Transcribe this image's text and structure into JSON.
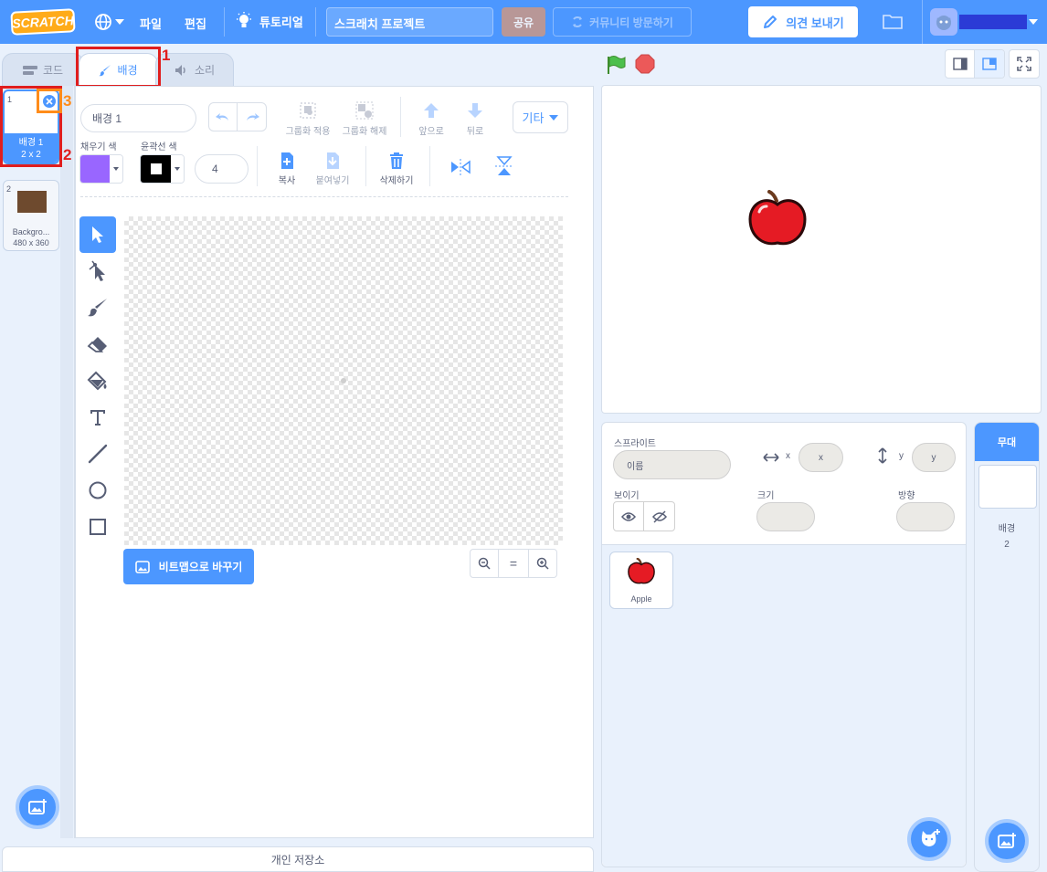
{
  "menubar": {
    "logo": "SCRATCH",
    "file": "파일",
    "edit": "편집",
    "tutorial": "튜토리얼",
    "project_title": "스크래치 프로젝트",
    "share": "공유",
    "community": "커뮤니티 방문하기",
    "feedback": "의견 보내기"
  },
  "tabs": {
    "code": "코드",
    "backdrop": "배경",
    "sound": "소리"
  },
  "costumes": [
    {
      "index": "1",
      "name": "배경 1",
      "size": "2 x 2"
    },
    {
      "index": "2",
      "name": "Backgro...",
      "size": "480 x 360"
    }
  ],
  "editor": {
    "costume_name": "배경 1",
    "group": "그룹화 적용",
    "ungroup": "그룹화 해제",
    "forward": "앞으로",
    "backward": "뒤로",
    "more": "기타",
    "fill_label": "채우기 색",
    "outline_label": "윤곽선 색",
    "outline_width": "4",
    "copy": "복사",
    "paste": "붙여넣기",
    "delete": "삭제하기",
    "convert_bitmap": "비트맵으로 바꾸기",
    "zoom_reset": "="
  },
  "sprite_info": {
    "sprite_label": "스프라이트",
    "name_placeholder": "이름",
    "x_label": "x",
    "y_label": "y",
    "x_placeholder": "x",
    "y_placeholder": "y",
    "show_label": "보이기",
    "size_label": "크기",
    "direction_label": "방향",
    "sprite_name": "Apple"
  },
  "stage_panel": {
    "title": "무대",
    "backdrops_label": "배경",
    "backdrops_count": "2"
  },
  "backpack": "개인 저장소",
  "annotations": {
    "a1": "1",
    "a2": "2",
    "a3": "3"
  },
  "colors": {
    "accent": "#4c97ff",
    "fill": "#9966ff",
    "outline": "#000000",
    "annotation_red": "#e01e1e",
    "annotation_orange": "#ff8c1a"
  }
}
